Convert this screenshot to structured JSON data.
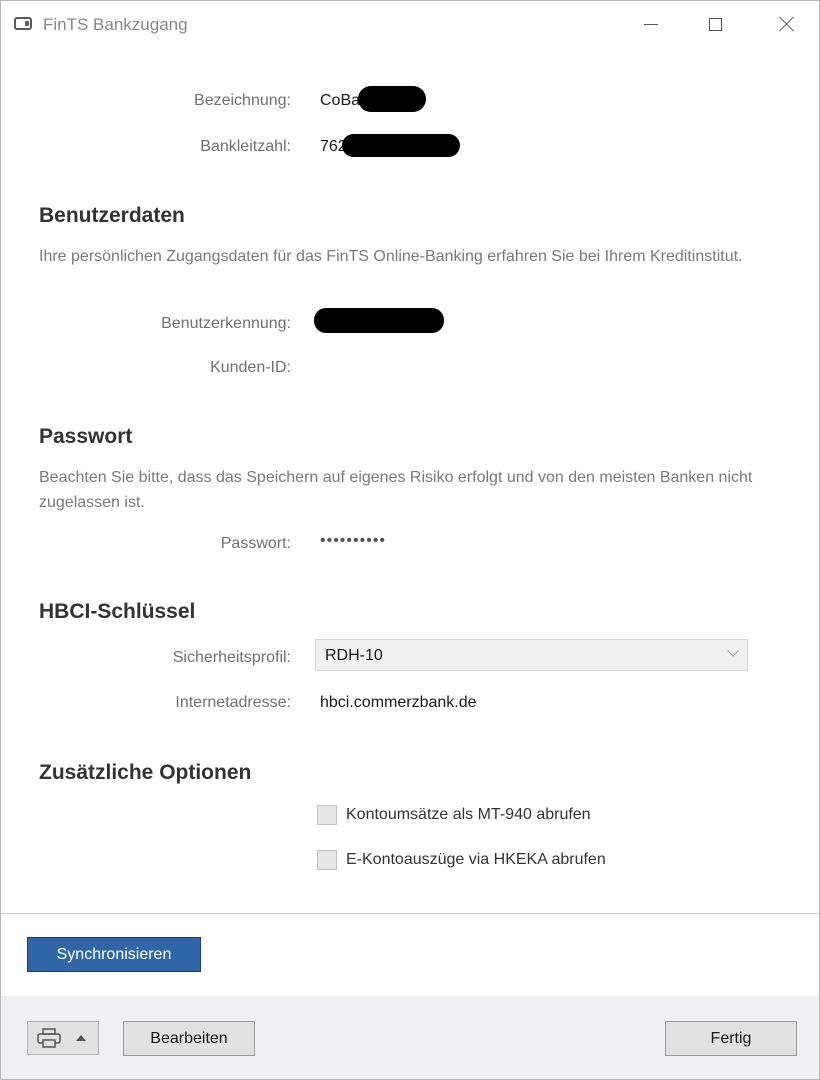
{
  "window": {
    "title": "FinTS Bankzugang"
  },
  "bank": {
    "name_label": "Bezeichnung:",
    "name_value": "CoBa",
    "blz_label": "Bankleitzahl:",
    "blz_value": "762"
  },
  "user_section": {
    "title": "Benutzerdaten",
    "description": "Ihre persönlichen Zugangsdaten für das FinTS Online-Banking erfahren Sie bei Ihrem Kreditinstitut.",
    "user_id_label": "Benutzerkennung:",
    "customer_id_label": "Kunden-ID:"
  },
  "password_section": {
    "title": "Passwort",
    "description": "Beachten Sie bitte, dass das Speichern auf eigenes Risiko erfolgt und von den meisten Banken nicht zugelassen ist.",
    "password_label": "Passwort:",
    "password_value": "••••••••••"
  },
  "hbci_section": {
    "title": "HBCI-Schlüssel",
    "security_profile_label": "Sicherheitsprofil:",
    "security_profile_value": "RDH-10",
    "internet_address_label": "Internetadresse:",
    "internet_address_value": "hbci.commerzbank.de"
  },
  "options_section": {
    "title": "Zusätzliche Optionen",
    "option_mt940_label": "Kontoumsätze als MT-940 abrufen",
    "option_mt940_checked": false,
    "option_hkeka_label": "E-Kontoauszüge via HKEKA abrufen",
    "option_hkeka_checked": false
  },
  "actions": {
    "sync_label": "Synchronisieren",
    "edit_label": "Bearbeiten",
    "done_label": "Fertig"
  },
  "icons": {
    "app": "bank-card-icon",
    "print": "printer-icon",
    "print_menu": "caret-up-icon",
    "minimize": "minimize-icon",
    "maximize": "maximize-icon",
    "close": "close-icon"
  },
  "colors": {
    "primary_button": "#2f66a8",
    "footer_background": "#f0f0f2"
  }
}
